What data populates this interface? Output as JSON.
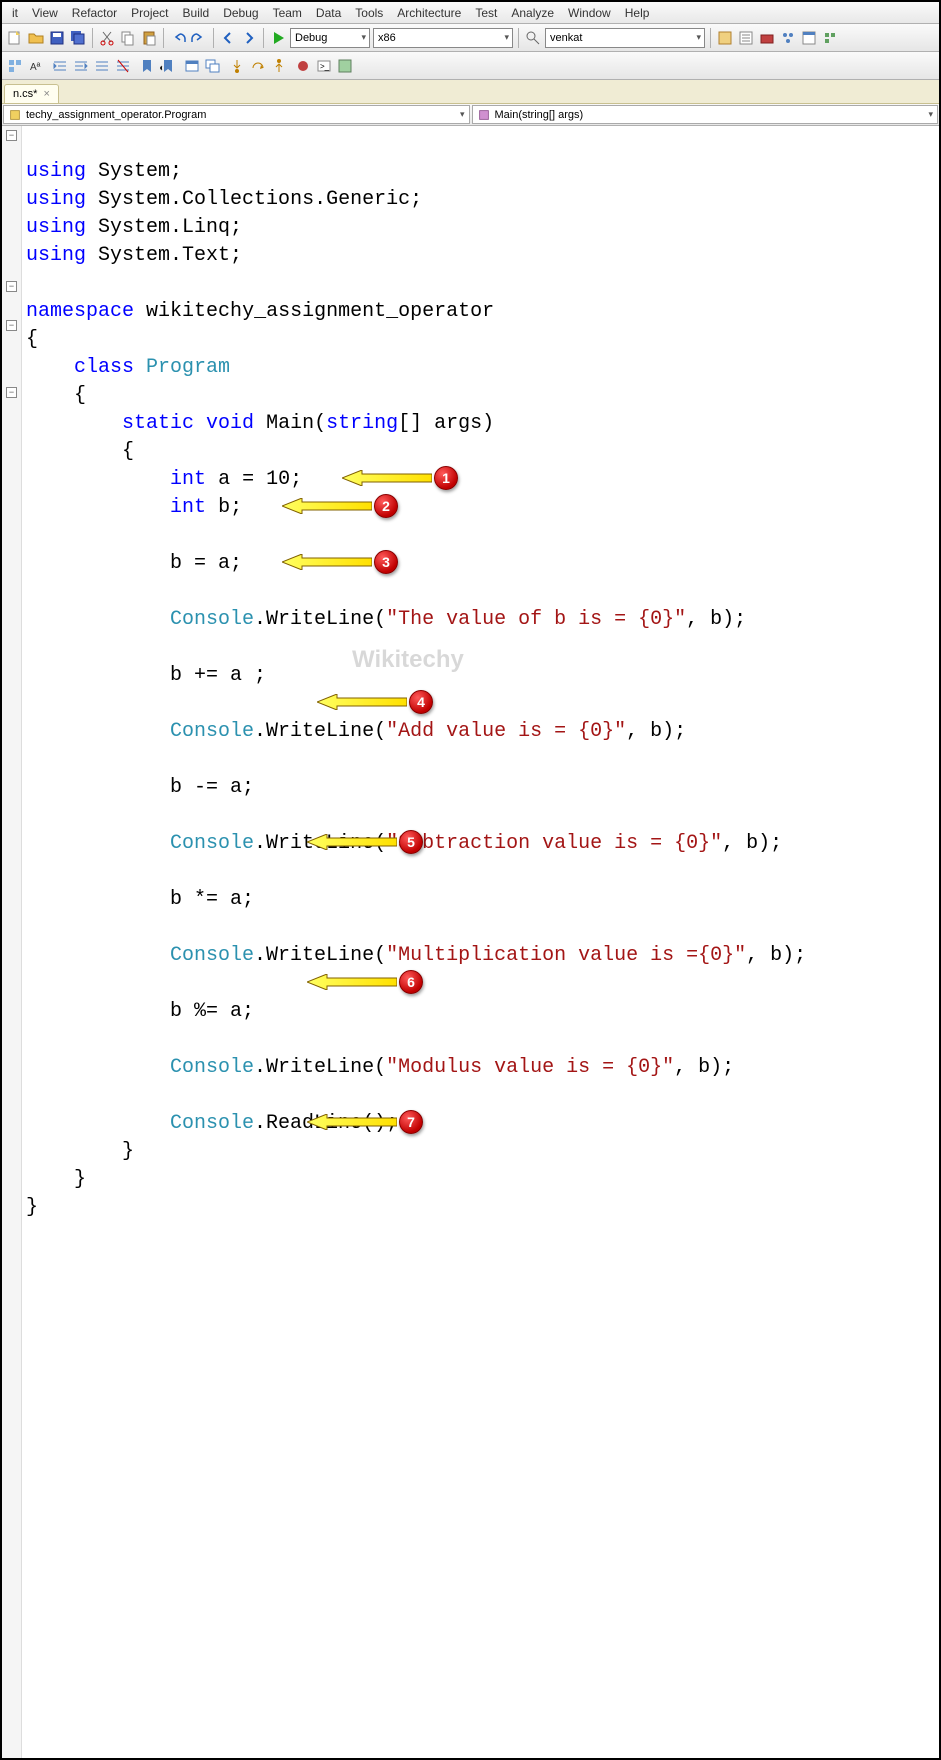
{
  "menu": [
    "it",
    "View",
    "Refactor",
    "Project",
    "Build",
    "Debug",
    "Team",
    "Data",
    "Tools",
    "Architecture",
    "Test",
    "Analyze",
    "Window",
    "Help"
  ],
  "toolbar": {
    "config": "Debug",
    "platform": "x86",
    "search": "venkat"
  },
  "tab": {
    "name": "n.cs*"
  },
  "nav": {
    "left": "techy_assignment_operator.Program",
    "right": "Main(string[] args)"
  },
  "code": {
    "l1_using": "using",
    "l1_sys": "System",
    "l1_semi": ";",
    "l2_using": "using",
    "l2_txt": "System.Collections.Generic;",
    "l3_using": "using",
    "l3_txt": "System.Linq;",
    "l4_using": "using",
    "l4_txt": "System.Text;",
    "ns": "namespace",
    "ns_txt": "wikitechy_assignment_operator",
    "obrace": "{",
    "class": "class",
    "prog": "Program",
    "obrace2": "{",
    "static": "static",
    "void": "void",
    "main": "Main(",
    "string": "string",
    "main2": "[] args)",
    "obrace3": "{",
    "int1": "int",
    "a10": "a = 10;",
    "int2": "int",
    "bdef": "b;",
    "beq": "b = a;",
    "console1": "Console",
    "wl": ".WriteLine(",
    "s1": "\"The value of b is = {0}\"",
    "rest1": ", b);",
    "bplus": "b += a ;",
    "console2": "Console",
    "s2": "\"Add value is = {0}\"",
    "rest2": ", b);",
    "bminus": "b -= a;",
    "console3": "Console",
    "s3": "\"Subtraction value is = {0}\"",
    "rest3": ", b);",
    "bmul": "b *= a;",
    "console4": "Console",
    "s4": "\"Multiplication value is ={0}\"",
    "rest4": ", b);",
    "bmod": "b %= a;",
    "console5": "Console",
    "s5": "\"Modulus value is = {0}\"",
    "rest5": ", b);",
    "console6": "Console",
    "rl": ".ReadLine();",
    "cbrace3": "}",
    "cbrace2": "}",
    "cbrace1": "}"
  },
  "callouts": [
    "1",
    "2",
    "3",
    "4",
    "5",
    "6",
    "7"
  ],
  "watermark": "Wikitechy"
}
